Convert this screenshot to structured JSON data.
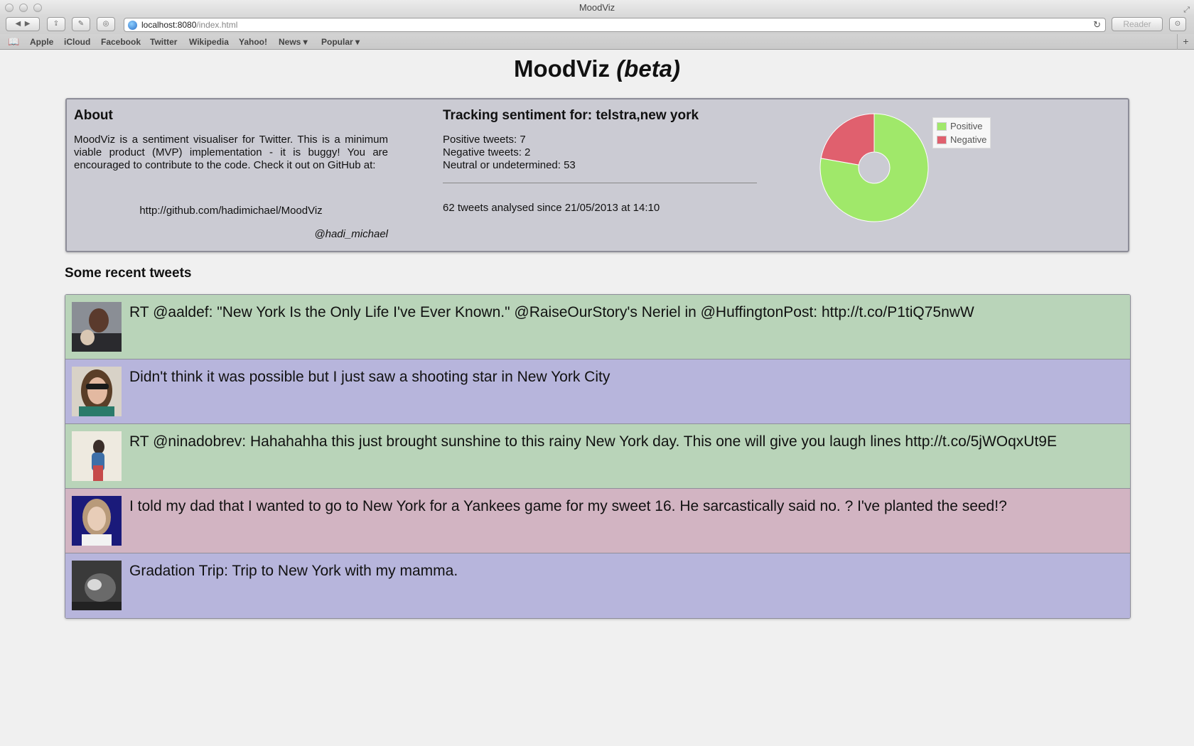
{
  "window": {
    "title": "MoodViz"
  },
  "browser": {
    "url_host": "localhost:8080",
    "url_path": "/index.html",
    "reader_label": "Reader",
    "bookmarks": [
      {
        "label": "Apple"
      },
      {
        "label": "iCloud"
      },
      {
        "label": "Facebook"
      },
      {
        "label": "Twitter"
      },
      {
        "label": "Wikipedia"
      },
      {
        "label": "Yahoo!"
      },
      {
        "label": "News ▾"
      },
      {
        "label": "Popular ▾"
      }
    ]
  },
  "page": {
    "title": "MoodViz",
    "title_suffix": "(beta)"
  },
  "about": {
    "heading": "About",
    "text": "MoodViz is a sentiment visualiser for Twitter. This is a minimum viable product (MVP) implementation - it is buggy! You are encouraged to contribute to the code. Check it out on GitHub at:",
    "link": "http://github.com/hadimichael/MoodViz",
    "handle": "@hadi_michael"
  },
  "tracking": {
    "heading": "Tracking sentiment for: telstra,new york",
    "positive": "Positive tweets: 7",
    "negative": "Negative tweets: 2",
    "neutral": "Neutral or undetermined: 53",
    "since": "62 tweets analysed since 21/05/2013 at 14:10"
  },
  "chart_data": {
    "type": "pie",
    "categories": [
      "Positive",
      "Negative"
    ],
    "values": [
      7,
      2
    ],
    "colors": [
      "#a0e86a",
      "#e0606e"
    ],
    "legend": "right"
  },
  "tweets_section": {
    "heading": "Some recent tweets"
  },
  "tweets": [
    {
      "text": "RT @aaldef: \"New York Is the Only Life I've Ever Known.\" @RaiseOurStory's Neriel in @HuffingtonPost: http://t.co/P1tiQ75nwW",
      "sentiment": "positive",
      "bg": "#b9d4b9"
    },
    {
      "text": "Didn't think it was possible but I just saw a shooting star in New York City",
      "sentiment": "neutral",
      "bg": "#b7b5dc"
    },
    {
      "text": "RT @ninadobrev: Hahahahha this just brought sunshine to this rainy New York day. This one will give you laugh lines http://t.co/5jWOqxUt9E",
      "sentiment": "positive",
      "bg": "#b9d4b9"
    },
    {
      "text": "I told my dad that I wanted to go to New York for a Yankees game for my sweet 16. He sarcastically said no. ? I've planted the seed!?",
      "sentiment": "negative",
      "bg": "#d2b4c2"
    },
    {
      "text": "Gradation Trip: Trip to New York with my mamma.",
      "sentiment": "neutral",
      "bg": "#b7b5dc"
    }
  ]
}
